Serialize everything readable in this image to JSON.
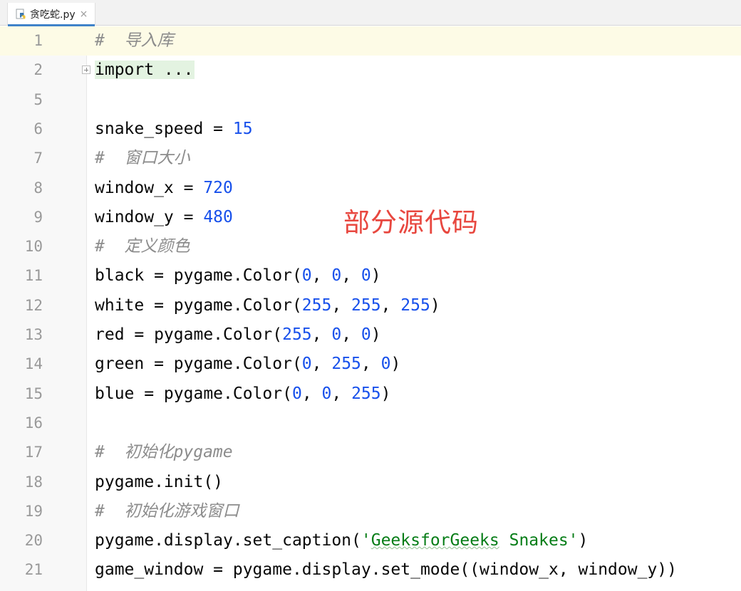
{
  "tab": {
    "filename": "贪吃蛇.py",
    "icon": "python-file-icon",
    "close": "×"
  },
  "lines": [
    {
      "no": "1",
      "current": true,
      "tokens": [
        {
          "t": "#  导入库",
          "c": "cmt"
        }
      ]
    },
    {
      "no": "2",
      "fold": true,
      "tokens": [
        {
          "t": "import ...",
          "c": "folded"
        }
      ]
    },
    {
      "no": "5",
      "tokens": []
    },
    {
      "no": "6",
      "tokens": [
        {
          "t": "snake_speed = ",
          "c": ""
        },
        {
          "t": "15",
          "c": "num"
        }
      ]
    },
    {
      "no": "7",
      "tokens": [
        {
          "t": "#  窗口大小",
          "c": "cmt"
        }
      ]
    },
    {
      "no": "8",
      "tokens": [
        {
          "t": "window_x = ",
          "c": ""
        },
        {
          "t": "720",
          "c": "num"
        }
      ]
    },
    {
      "no": "9",
      "tokens": [
        {
          "t": "window_y = ",
          "c": ""
        },
        {
          "t": "480",
          "c": "num"
        }
      ]
    },
    {
      "no": "10",
      "tokens": [
        {
          "t": "#  定义颜色",
          "c": "cmt"
        }
      ]
    },
    {
      "no": "11",
      "tokens": [
        {
          "t": "black = pygame.Color(",
          "c": ""
        },
        {
          "t": "0",
          "c": "num"
        },
        {
          "t": ", ",
          "c": ""
        },
        {
          "t": "0",
          "c": "num"
        },
        {
          "t": ", ",
          "c": ""
        },
        {
          "t": "0",
          "c": "num"
        },
        {
          "t": ")",
          "c": ""
        }
      ]
    },
    {
      "no": "12",
      "tokens": [
        {
          "t": "white = pygame.Color(",
          "c": ""
        },
        {
          "t": "255",
          "c": "num"
        },
        {
          "t": ", ",
          "c": ""
        },
        {
          "t": "255",
          "c": "num"
        },
        {
          "t": ", ",
          "c": ""
        },
        {
          "t": "255",
          "c": "num"
        },
        {
          "t": ")",
          "c": ""
        }
      ]
    },
    {
      "no": "13",
      "tokens": [
        {
          "t": "red = pygame.Color(",
          "c": ""
        },
        {
          "t": "255",
          "c": "num"
        },
        {
          "t": ", ",
          "c": ""
        },
        {
          "t": "0",
          "c": "num"
        },
        {
          "t": ", ",
          "c": ""
        },
        {
          "t": "0",
          "c": "num"
        },
        {
          "t": ")",
          "c": ""
        }
      ]
    },
    {
      "no": "14",
      "tokens": [
        {
          "t": "green = pygame.Color(",
          "c": ""
        },
        {
          "t": "0",
          "c": "num"
        },
        {
          "t": ", ",
          "c": ""
        },
        {
          "t": "255",
          "c": "num"
        },
        {
          "t": ", ",
          "c": ""
        },
        {
          "t": "0",
          "c": "num"
        },
        {
          "t": ")",
          "c": ""
        }
      ]
    },
    {
      "no": "15",
      "tokens": [
        {
          "t": "blue = pygame.Color(",
          "c": ""
        },
        {
          "t": "0",
          "c": "num"
        },
        {
          "t": ", ",
          "c": ""
        },
        {
          "t": "0",
          "c": "num"
        },
        {
          "t": ", ",
          "c": ""
        },
        {
          "t": "255",
          "c": "num"
        },
        {
          "t": ")",
          "c": ""
        }
      ]
    },
    {
      "no": "16",
      "tokens": []
    },
    {
      "no": "17",
      "tokens": [
        {
          "t": "#  初始化pygame",
          "c": "cmt"
        }
      ]
    },
    {
      "no": "18",
      "tokens": [
        {
          "t": "pygame.init()",
          "c": ""
        }
      ]
    },
    {
      "no": "19",
      "tokens": [
        {
          "t": "#  初始化游戏窗口",
          "c": "cmt"
        }
      ]
    },
    {
      "no": "20",
      "tokens": [
        {
          "t": "pygame.display.set_caption(",
          "c": ""
        },
        {
          "t": "'",
          "c": "str"
        },
        {
          "t": "GeeksforGeeks",
          "c": "str spell"
        },
        {
          "t": " Snakes'",
          "c": "str"
        },
        {
          "t": ")",
          "c": ""
        }
      ]
    },
    {
      "no": "21",
      "tokens": [
        {
          "t": "game_window = pygame.display.set_mode((window_x, window_y))",
          "c": ""
        }
      ]
    }
  ],
  "overlay_text": "部分源代码",
  "colors": {
    "comment": "#8c8c8c",
    "number": "#1750eb",
    "string": "#067d17",
    "overlay": "#e8473f",
    "current_line": "#fdfbe6",
    "folded_bg": "#e3f3e1"
  }
}
